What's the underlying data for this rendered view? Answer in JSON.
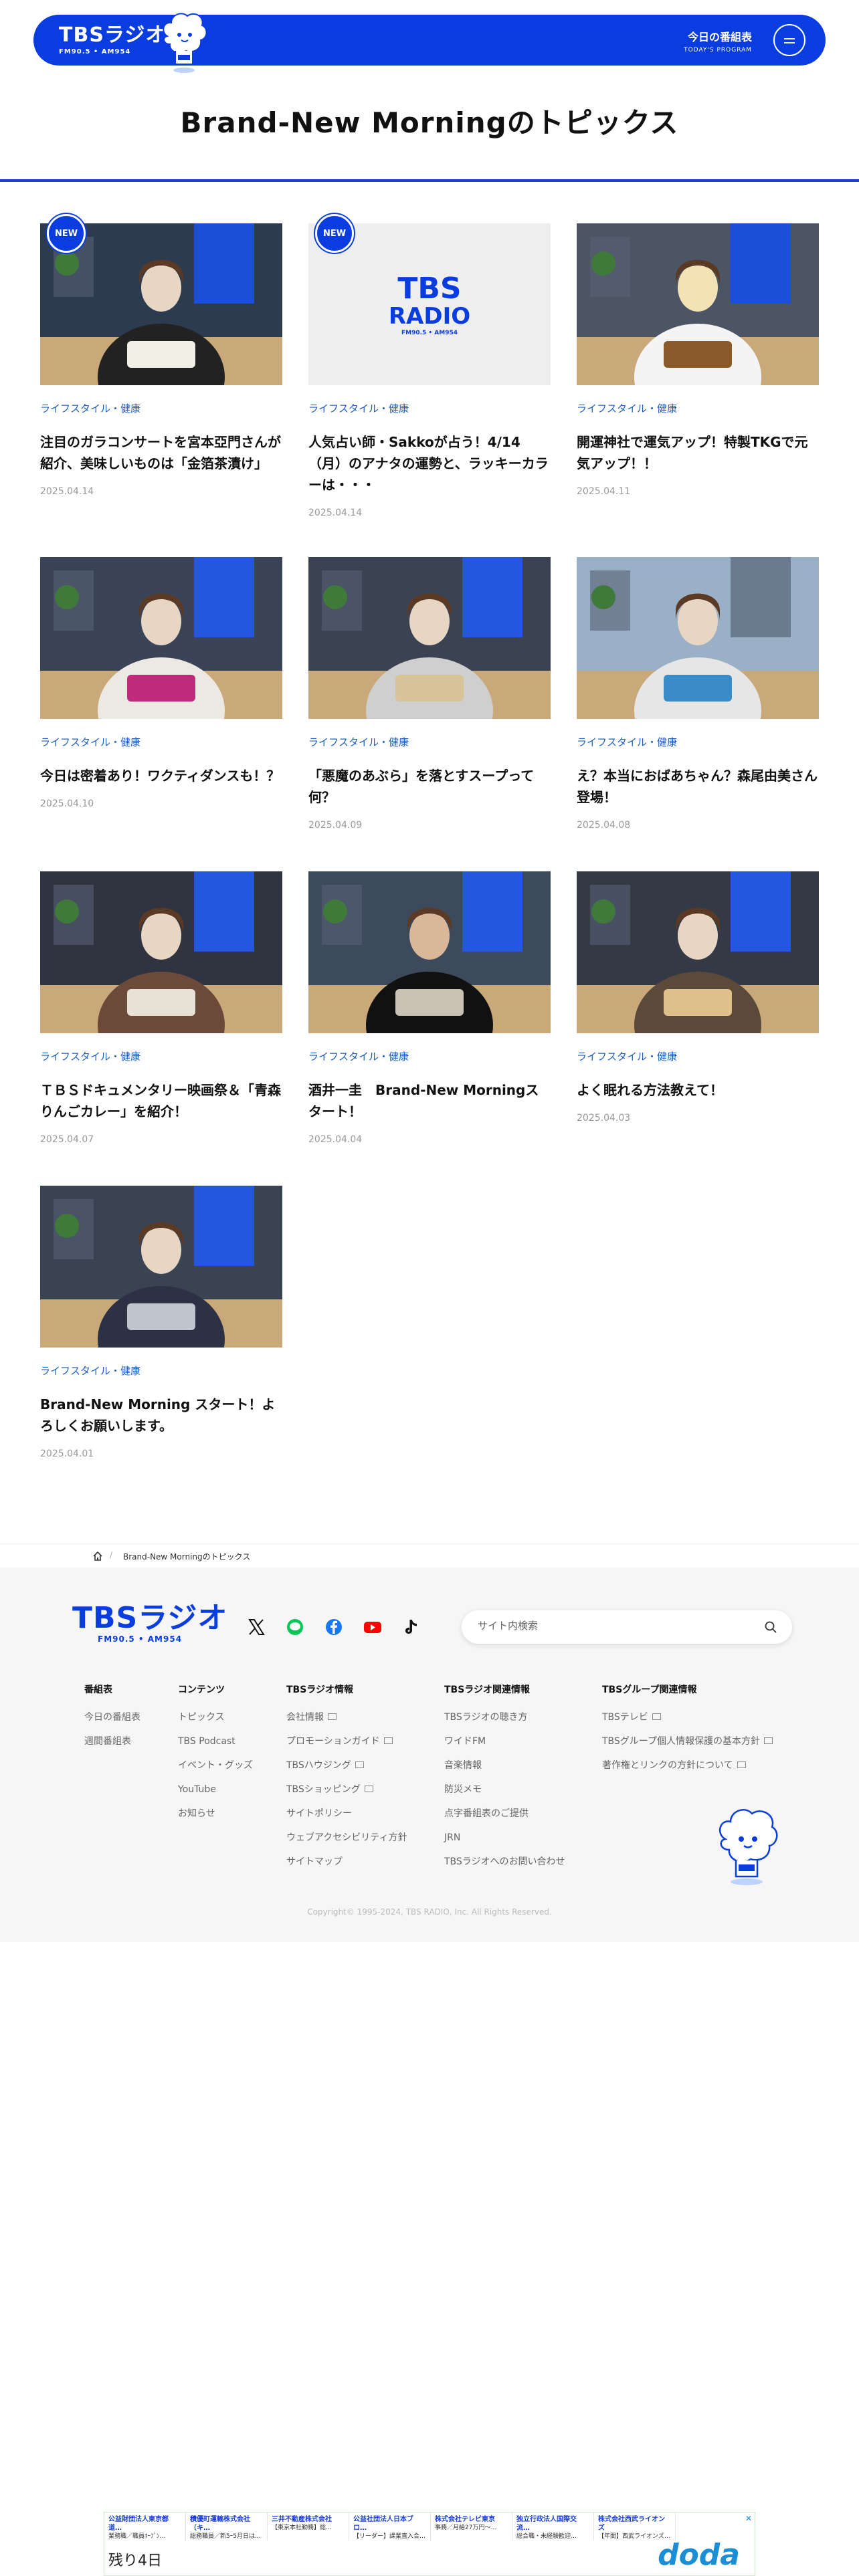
{
  "header": {
    "logo_main": "TBSラジオ",
    "logo_sub": "FM90.5 • AM954",
    "program_jp": "今日の番組表",
    "program_en": "TODAY'S PROGRAM"
  },
  "page_title": "Brand-New Morningのトピックス",
  "new_badge": "NEW",
  "tbs_radio_card": {
    "line1": "TBS",
    "line2": "RADIO",
    "line3": "FM90.5 • AM954"
  },
  "articles": [
    {
      "category": "ライフスタイル・健康",
      "title": "注目のガラコンサートを宮本亞門さんが紹介、美味しいものは「金箔茶漬け」",
      "date": "2025.04.14",
      "is_new": true
    },
    {
      "category": "ライフスタイル・健康",
      "title": "人気占い師・Sakkoが占う！4/14（月）のアナタの運勢と、ラッキーカラーは・・・",
      "date": "2025.04.14",
      "is_new": true
    },
    {
      "category": "ライフスタイル・健康",
      "title": "開運神社で運気アップ！特製TKGで元気アップ！！",
      "date": "2025.04.11",
      "is_new": false
    },
    {
      "category": "ライフスタイル・健康",
      "title": "今日は密着あり！ワクティダンスも！？",
      "date": "2025.04.10",
      "is_new": false
    },
    {
      "category": "ライフスタイル・健康",
      "title": "「悪魔のあぶら」を落とすスープって何？",
      "date": "2025.04.09",
      "is_new": false
    },
    {
      "category": "ライフスタイル・健康",
      "title": "え？本当におばあちゃん？森尾由美さん登場！",
      "date": "2025.04.08",
      "is_new": false
    },
    {
      "category": "ライフスタイル・健康",
      "title": "ＴＢＳドキュメンタリー映画祭＆「青森りんごカレー」を紹介！",
      "date": "2025.04.07",
      "is_new": false
    },
    {
      "category": "ライフスタイル・健康",
      "title": "酒井一圭　Brand-New Morningスタート！",
      "date": "2025.04.04",
      "is_new": false
    },
    {
      "category": "ライフスタイル・健康",
      "title": "よく眠れる方法教えて！",
      "date": "2025.04.03",
      "is_new": false
    },
    {
      "category": "ライフスタイル・健康",
      "title": "Brand-New Morning スタート！よろしくお願いします。",
      "date": "2025.04.01",
      "is_new": false
    }
  ],
  "breadcrumb": {
    "separator": "/",
    "current": "Brand-New Morningのトピックス"
  },
  "footer": {
    "logo_main": "TBSラジオ",
    "logo_sub": "FM90.5 • AM954",
    "search_placeholder": "サイト内検索",
    "columns": [
      {
        "heading": "番組表",
        "items": [
          "今日の番組表",
          "週間番組表"
        ]
      },
      {
        "heading": "コンテンツ",
        "items": [
          "トピックス",
          "TBS Podcast",
          "イベント・グッズ",
          "YouTube",
          "お知らせ"
        ]
      },
      {
        "heading": "TBSラジオ情報",
        "items": [
          "会社情報",
          "プロモーションガイド",
          "TBSハウジング",
          "TBSショッピング",
          "サイトポリシー",
          "ウェブアクセシビリティ方針",
          "サイトマップ"
        ]
      },
      {
        "heading": "TBSラジオ関連情報",
        "items": [
          "TBSラジオの聴き方",
          "ワイドFM",
          "音楽情報",
          "防災メモ",
          "点字番組表のご提供",
          "JRN",
          "TBSラジオへのお問い合わせ"
        ]
      },
      {
        "heading": "TBSグループ関連情報",
        "items": [
          "TBSテレビ",
          "TBSグループ個人情報保護の基本方針",
          "著作権とリンクの方針について"
        ]
      }
    ],
    "external_items": [
      "会社情報",
      "プロモーションガイド",
      "TBSハウジング",
      "TBSショッピング",
      "TBSテレビ",
      "TBSグループ個人情報保護の基本方針",
      "著作権とリンクの方針について"
    ],
    "copyright": "Copyright© 1995-2024, TBS RADIO, Inc. All Rights Reserved."
  },
  "ad": {
    "companies": [
      {
        "name": "公益財団法人東京都道…",
        "desc": "業務職／職員ﾎｰﾌﾟﾝ…"
      },
      {
        "name": "積優町運輸株式会社（キ…",
        "desc": "総務職員／新5ｰ5月日は…"
      },
      {
        "name": "三井不動産株式会社",
        "desc": "【東京本社勤務】総…"
      },
      {
        "name": "公益社団法人日本ブロ…",
        "desc": "【リーダー】課業直入合…"
      },
      {
        "name": "株式会社テレビ東京",
        "desc": "事務／月給27万円～…"
      },
      {
        "name": "独立行政法人国際交流…",
        "desc": "総合職・未経験歓迎…"
      },
      {
        "name": "株式会社西武ライオンズ",
        "desc": "【年間】西武ライオンズ…"
      }
    ],
    "days_left": "残り4日",
    "brand": "doda",
    "close": "✕"
  },
  "colors": {
    "brand_blue": "#0a3de0",
    "category_blue": "#1e5fc0"
  }
}
